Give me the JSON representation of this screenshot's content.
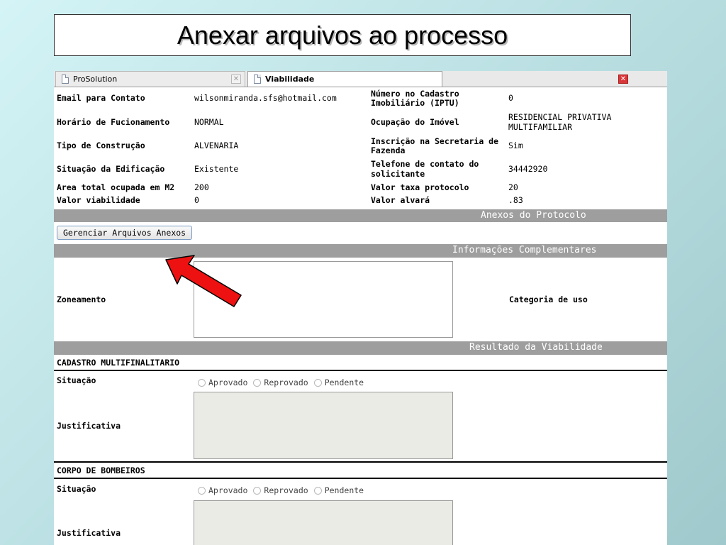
{
  "slide": {
    "title": "Anexar arquivos ao processo"
  },
  "tabs": [
    {
      "label": "ProSolution",
      "active": false
    },
    {
      "label": "Viabilidade",
      "active": true
    }
  ],
  "fields_left": [
    {
      "label": "Email para Contato",
      "value": "wilsonmiranda.sfs@hotmail.com"
    },
    {
      "label": "Horário de Fucionamento",
      "value": "NORMAL"
    },
    {
      "label": "Tipo de Construção",
      "value": "ALVENARIA"
    },
    {
      "label": "Situação da Edificação",
      "value": "Existente"
    },
    {
      "label": "Area total ocupada em M2",
      "value": "200"
    },
    {
      "label": "Valor viabilidade",
      "value": "0"
    }
  ],
  "fields_right": [
    {
      "label_line1": "Número no Cadastro",
      "label_line2": "Imobiliário (IPTU)",
      "value_line1": "0",
      "value_line2": ""
    },
    {
      "label_line1": "Ocupação do Imóvel",
      "label_line2": "",
      "value_line1": "RESIDENCIAL PRIVATIVA",
      "value_line2": "MULTIFAMILIAR"
    },
    {
      "label_line1": "Inscrição na Secretaria de",
      "label_line2": "Fazenda",
      "value_line1": "Sim",
      "value_line2": ""
    },
    {
      "label_line1": "Telefone de contato do",
      "label_line2": "solicitante",
      "value_line1": "34442920",
      "value_line2": ""
    },
    {
      "label_line1": "Valor taxa protocolo",
      "label_line2": "",
      "value_line1": "20",
      "value_line2": ""
    },
    {
      "label_line1": "Valor alvará",
      "label_line2": "",
      "value_line1": ".83",
      "value_line2": ""
    }
  ],
  "sections": {
    "anexos": "Anexos do Protocolo",
    "info": "Informações Complementares",
    "resultado": "Resultado da Viabilidade"
  },
  "manage_button": "Gerenciar Arquivos Anexos",
  "info": {
    "zoneamento_label": "Zoneamento",
    "categoria_label": "Categoria de uso"
  },
  "resultado": [
    {
      "header": "CADASTRO MULTIFINALITARIO",
      "situacao_label": "Situação",
      "options": [
        "Aprovado",
        "Reprovado",
        "Pendente"
      ],
      "justificativa_label": "Justificativa"
    },
    {
      "header": "CORPO DE BOMBEIROS",
      "situacao_label": "Situação",
      "options": [
        "Aprovado",
        "Reprovado",
        "Pendente"
      ],
      "justificativa_label": "Justificativa"
    }
  ],
  "colors": {
    "arrow": "#ee1111",
    "section_bar": "#9e9e9e",
    "close_tab": "#d8373a"
  }
}
